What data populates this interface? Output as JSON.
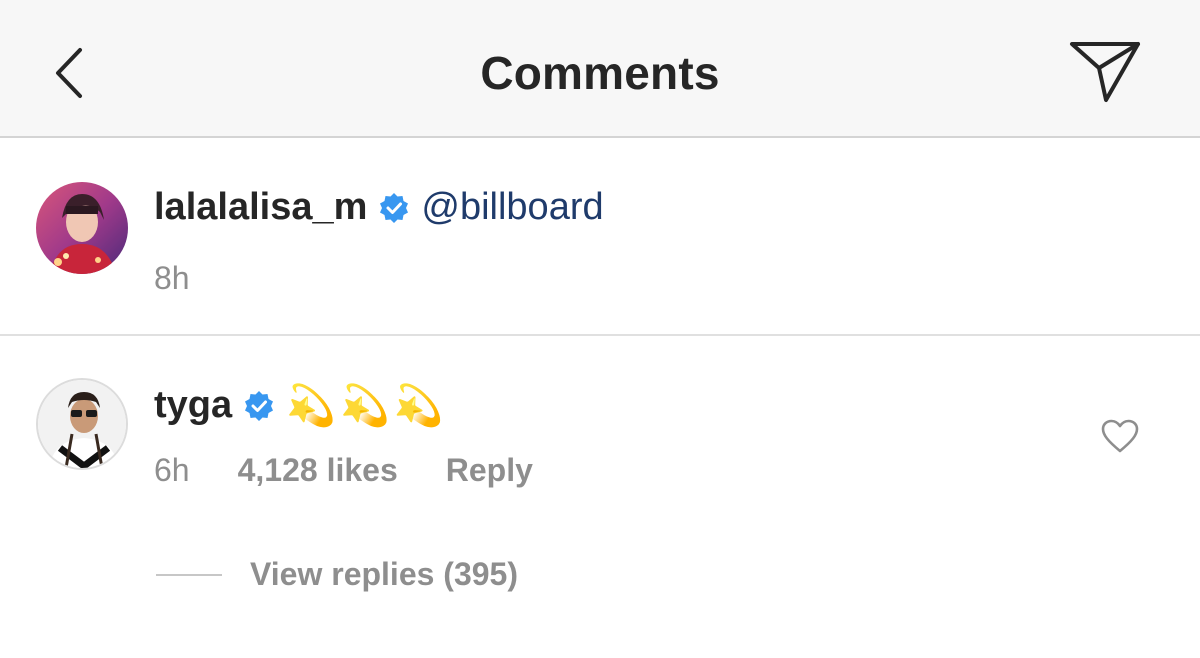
{
  "header": {
    "title": "Comments",
    "back_icon": "chevron-left-icon",
    "send_icon": "paper-plane-icon"
  },
  "comments": [
    {
      "username": "lalalalisa_m",
      "verified": true,
      "text": "@billboard",
      "time": "8h"
    },
    {
      "username": "tyga",
      "verified": true,
      "text": "💫💫💫",
      "time": "6h",
      "likes": "4,128 likes",
      "reply_label": "Reply",
      "view_replies": "View replies (395)"
    }
  ],
  "colors": {
    "header_bg": "#f7f7f7",
    "text_primary": "#262626",
    "text_secondary": "#8e8e8e",
    "mention": "#1f3b6b",
    "verified_badge": "#3897f0"
  }
}
